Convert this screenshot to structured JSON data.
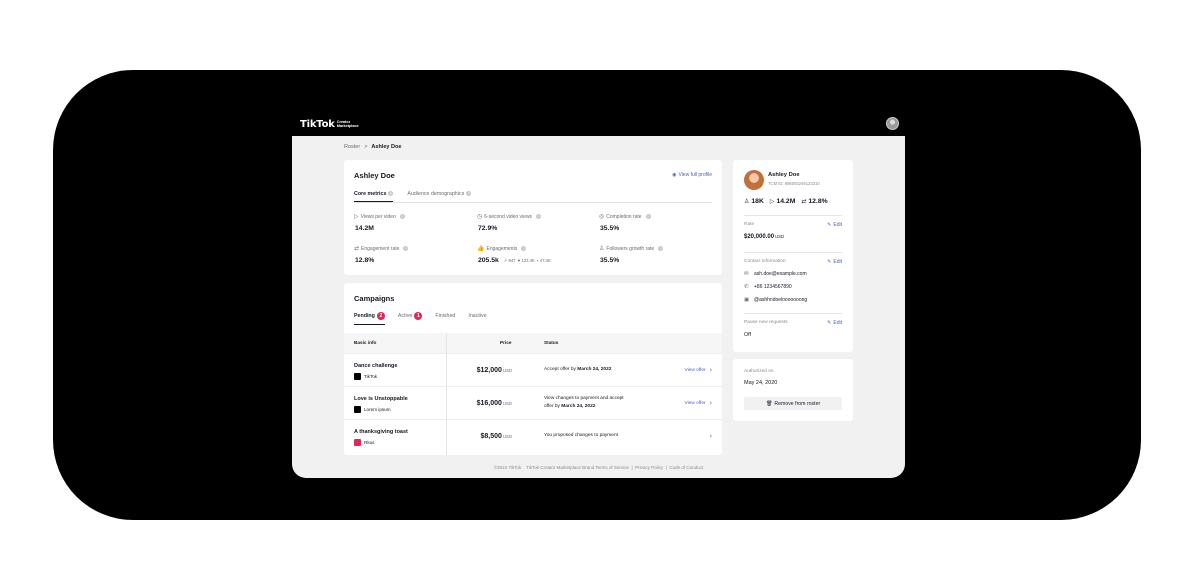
{
  "app": {
    "logo": "TikTok",
    "logo_sub_1": "Creator",
    "logo_sub_2": "Marketplace"
  },
  "breadcrumb": {
    "root": "Roster",
    "separator": ">",
    "current": "Ashley Doe"
  },
  "profile": {
    "name": "Ashley Doe",
    "view_full_profile": "View full profile",
    "tabs": [
      "Core metrics",
      "Audience demographics"
    ],
    "metrics": [
      {
        "label": "Views per video",
        "value": "14.2M",
        "icon": "play-circle-icon"
      },
      {
        "label": "6-second video views",
        "value": "72.9%",
        "icon": "clock-icon"
      },
      {
        "label": "Completion rate",
        "value": "35.5%",
        "icon": "check-circle-icon"
      },
      {
        "label": "Engagement rate",
        "value": "12.8%",
        "icon": "repeat-icon"
      },
      {
        "label": "Engagements",
        "value": "205.5k",
        "icon": "thumb-icon",
        "sub": [
          "947",
          "123.4K",
          "47.3K"
        ]
      },
      {
        "label": "Followers growth rate",
        "value": "35.5%",
        "icon": "user-plus-icon"
      }
    ]
  },
  "campaigns": {
    "title": "Campaigns",
    "tabs": [
      {
        "label": "Pending",
        "badge": "2"
      },
      {
        "label": "Active",
        "badge": "1"
      },
      {
        "label": "Finished",
        "badge": ""
      },
      {
        "label": "Inactive",
        "badge": ""
      }
    ],
    "columns": [
      "Basic info",
      "Price",
      "Status"
    ],
    "rows": [
      {
        "name": "Dance challenge",
        "brand": "TikTok",
        "price": "$12,000",
        "currency": "USD",
        "status_1": "Accept offer by",
        "status_date": "March 24, 2022",
        "status_2": "",
        "action": "View offer"
      },
      {
        "name": "Love is Unstoppable",
        "brand": "Lorem ipsum",
        "price": "$16,000",
        "currency": "USD",
        "status_1": "View changes to payment and accept",
        "status_date": "March 24, 2022",
        "status_2": "offer by",
        "action": "View offer"
      },
      {
        "name": "A thanksgiving toast",
        "brand": "Rkus",
        "price": "$8,500",
        "currency": "USD",
        "status_1": "You proposed changes to payment",
        "status_date": "",
        "status_2": "",
        "action": ""
      }
    ]
  },
  "side": {
    "name": "Ashley Doe",
    "tcm_id": "TCM ID: 986083249123310",
    "followers": "18K",
    "views": "14.2M",
    "engagement": "12.8%",
    "rate_label": "Rate",
    "rate_value": "$20,000.00",
    "rate_currency": "USD",
    "edit": "Edit",
    "contact_label": "Contact information",
    "email": "ash.doe@example.com",
    "phone": "+86 1234567890",
    "handle": "@ashhndoelooooooong",
    "pause_label": "Pause new requests",
    "pause_value": "Off"
  },
  "auth": {
    "label": "Authorized on",
    "date": "May 24, 2020",
    "remove": "Remove from roster"
  },
  "footer": {
    "copyright": "©2022 TikTok",
    "terms": "TikTok Creator Marketplace Brand Terms of Service",
    "privacy": "Privacy Policy",
    "conduct": "Code of Conduct",
    "sep": "|"
  },
  "colors": {
    "accent": "#4a63b8",
    "badge": "#e1265a",
    "topbar": "#000000",
    "background": "#f1f1f2"
  }
}
